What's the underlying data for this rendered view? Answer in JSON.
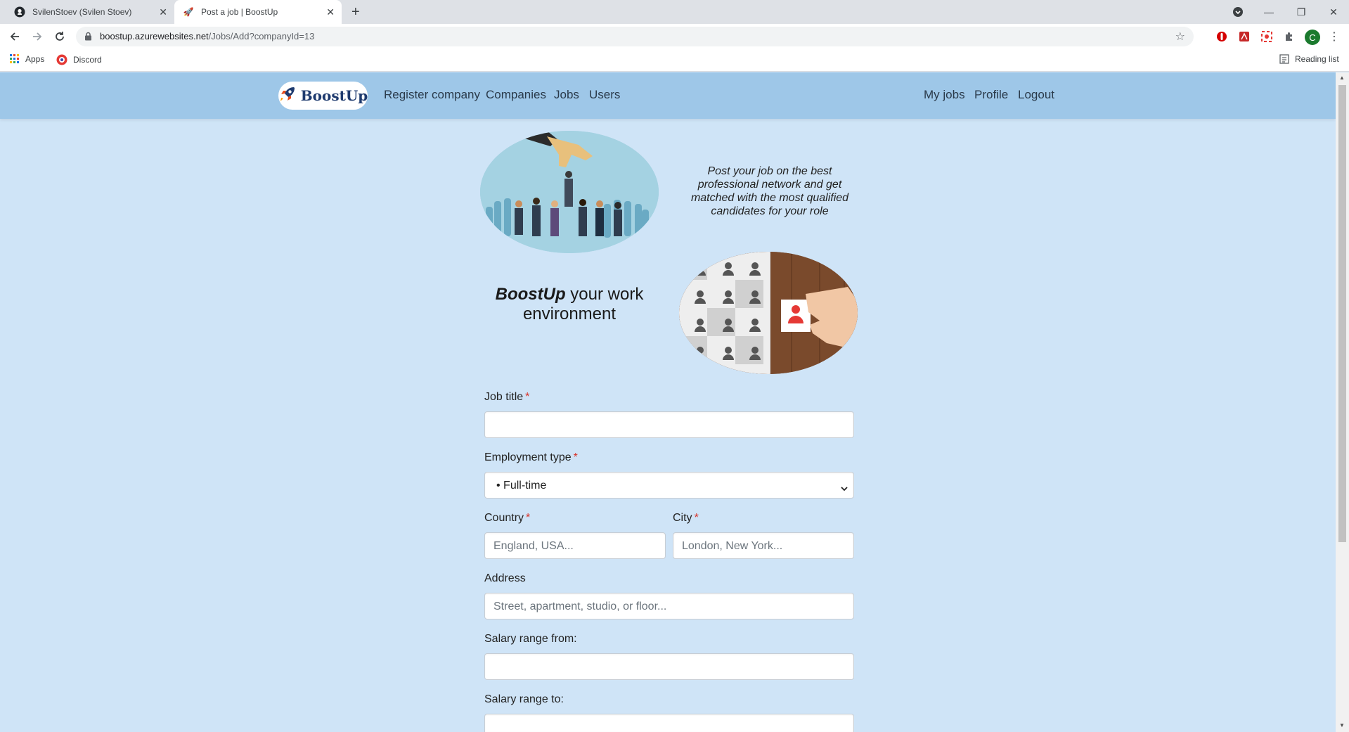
{
  "browser": {
    "tabs": [
      {
        "title": "SvilenStoev (Svilen Stoev)",
        "icon": "github-icon"
      },
      {
        "title": "Post a job | BoostUp",
        "icon": "rocket-icon",
        "active": true
      }
    ],
    "url_host": "boostup.azurewebsites.net",
    "url_path": "/Jobs/Add?companyId=13",
    "bookmarks": [
      {
        "label": "Apps",
        "icon": "apps-grid-icon"
      },
      {
        "label": "Discord",
        "icon": "discord-icon"
      }
    ],
    "reading_list": "Reading list",
    "profile_initial": "C"
  },
  "navbar": {
    "brand": "BoostUp",
    "left_links": [
      "Register company",
      "Companies",
      "Jobs",
      "Users"
    ],
    "right_links": [
      "My jobs",
      "Profile",
      "Logout"
    ]
  },
  "hero": {
    "tagline": "Post your job on the best professional network and get matched with the most qualified candidates for your role",
    "slogan_brand": "BoostUp",
    "slogan_rest": " your work environment"
  },
  "form": {
    "job_title": {
      "label": "Job title",
      "required": "*",
      "value": ""
    },
    "employment_type": {
      "label": "Employment type",
      "required": "*",
      "selected": "• Full-time"
    },
    "country": {
      "label": "Country",
      "required": "*",
      "placeholder": "England, USA..."
    },
    "city": {
      "label": "City",
      "required": "*",
      "placeholder": "London, New York..."
    },
    "address": {
      "label": "Address",
      "placeholder": "Street, apartment, studio, or floor..."
    },
    "salary_from": {
      "label": "Salary range from:"
    },
    "salary_to": {
      "label": "Salary range to:"
    }
  },
  "colors": {
    "page_bg": "#cfe4f7",
    "navbar_bg": "#9ec7e8",
    "required_star": "#d93025"
  }
}
